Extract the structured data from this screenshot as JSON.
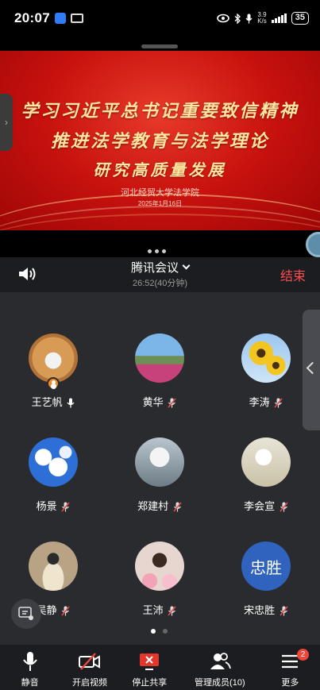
{
  "status_bar": {
    "time": "20:07",
    "net_speed_value": "3.9",
    "net_speed_unit": "K/s",
    "battery": "35"
  },
  "shared_screen": {
    "line1": "学习习近平总书记重要致信精神",
    "line2": "推进法学教育与法学理论",
    "line3": "研究高质量发展",
    "org": "河北经贸大学法学院",
    "date": "2025年1月16日"
  },
  "meeting": {
    "title": "腾讯会议",
    "subtitle": "26:52(40分钟)",
    "end_label": "结束"
  },
  "participants": [
    {
      "name": "王艺帆",
      "avatar_icon": "dog-avatar",
      "mic": "on",
      "host": true
    },
    {
      "name": "黄华",
      "avatar_icon": "field-avatar",
      "mic": "muted"
    },
    {
      "name": "李涛",
      "avatar_icon": "sunflower-avatar",
      "mic": "muted"
    },
    {
      "name": "杨景",
      "avatar_icon": "cloud-avatar",
      "mic": "muted"
    },
    {
      "name": "郑建村",
      "avatar_icon": "flowers-avatar",
      "mic": "muted"
    },
    {
      "name": "李会宣",
      "avatar_icon": "still-life-avatar",
      "mic": "muted"
    },
    {
      "name": "吴静",
      "avatar_icon": "person-avatar",
      "mic": "muted"
    },
    {
      "name": "王沛",
      "avatar_icon": "person-avatar",
      "mic": "muted"
    },
    {
      "name": "宋忠胜",
      "avatar_text": "忠胜",
      "mic": "muted"
    }
  ],
  "pagination": {
    "current": 1,
    "total": 2
  },
  "toolbar": {
    "mute_label": "静音",
    "video_label": "开启视频",
    "share_label": "停止共享",
    "members_label": "管理成员(10)",
    "more_label": "更多",
    "more_badge": "2"
  },
  "colors": {
    "end_red": "#ff4d4f",
    "avatar_blue": "#2f63bd",
    "host_orange": "#f08a24",
    "share_red": "#e2372c"
  }
}
